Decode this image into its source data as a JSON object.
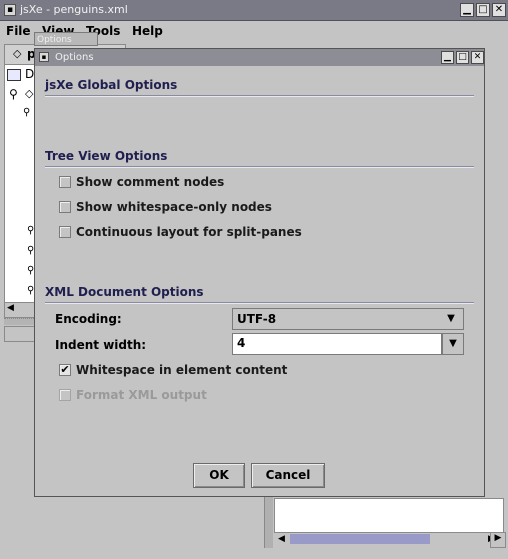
{
  "main_window": {
    "title": "jsXe - penguins.xml",
    "controls": {
      "minimize": "▁",
      "maximize": "□",
      "close": "✕"
    }
  },
  "menubar": [
    "File",
    "View",
    "Tools",
    "Help"
  ],
  "ghost_title": "Options",
  "background": {
    "tab_label_fragment": "p",
    "tree_label_fragment": "D"
  },
  "dialog": {
    "title": "Options",
    "controls": {
      "minimize": "▁",
      "maximize": "□",
      "close": "✕"
    },
    "global_section": "jsXe Global Options",
    "tree_section": "Tree View Options",
    "tree_options": [
      {
        "label": "Show comment nodes",
        "checked": false,
        "enabled": true
      },
      {
        "label": "Show whitespace-only nodes",
        "checked": false,
        "enabled": true
      },
      {
        "label": "Continuous layout for split-panes",
        "checked": false,
        "enabled": true
      }
    ],
    "xml_section": "XML Document Options",
    "encoding_label": "Encoding:",
    "encoding_value": "UTF-8",
    "indent_label": "Indent width:",
    "indent_value": "4",
    "xml_options": [
      {
        "label": "Whitespace in element content",
        "checked": true,
        "enabled": true
      },
      {
        "label": "Format XML output",
        "checked": false,
        "enabled": false
      }
    ],
    "ok_label": "OK",
    "cancel_label": "Cancel"
  }
}
